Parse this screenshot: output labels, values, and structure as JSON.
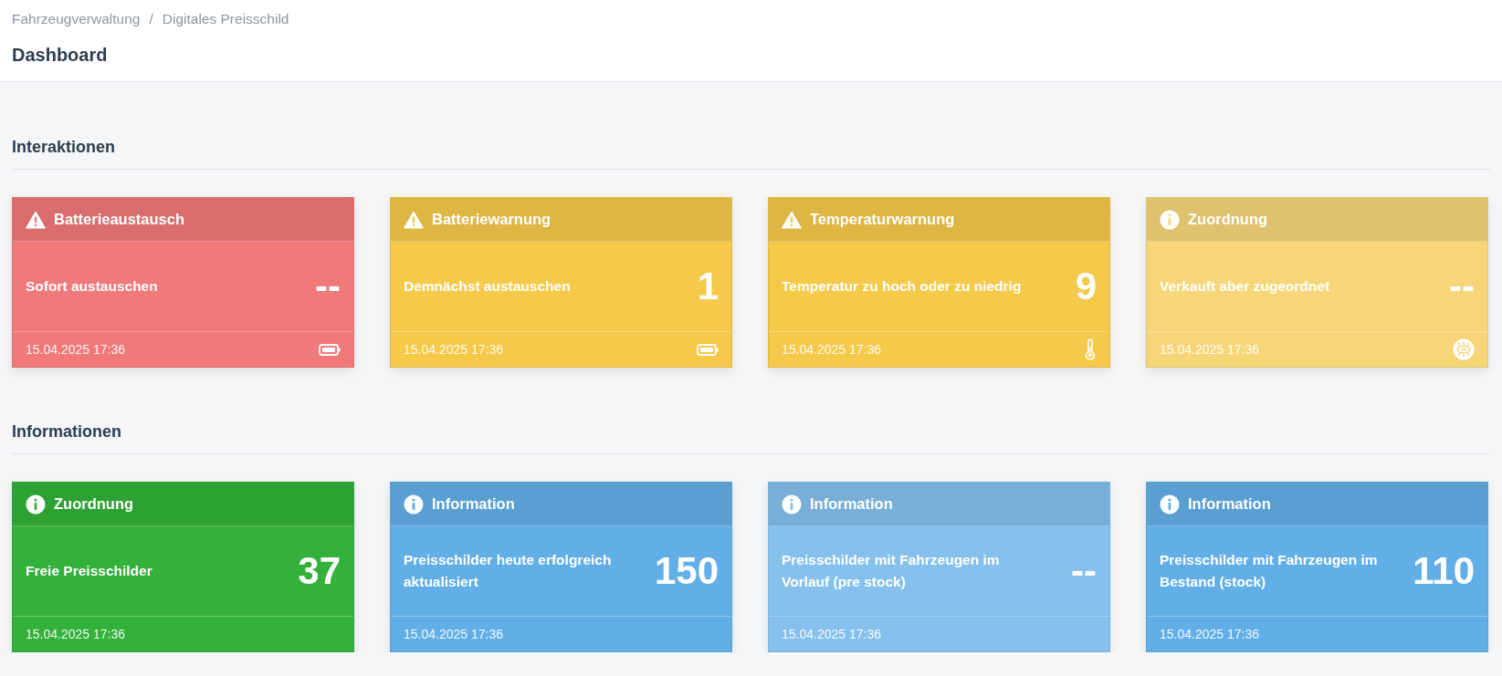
{
  "breadcrumb": [
    {
      "label": "Fahrzeugverwaltung"
    },
    {
      "separator": "/",
      "label": "Digitales Preisschild"
    }
  ],
  "page_title": "Dashboard",
  "sections": [
    {
      "title": "Interaktionen",
      "cards": [
        {
          "kind": "warning",
          "title": "Batterieaustausch",
          "label": "Sofort austauschen",
          "value": "--",
          "footer": {
            "kind": "battery",
            "timestamp": "15.04.2025 17:36"
          },
          "color": "#f07979"
        },
        {
          "kind": "warning",
          "title": "Batteriewarnung",
          "label": "Demnächst austauschen",
          "value": "1",
          "footer": {
            "kind": "battery",
            "timestamp": "15.04.2025 17:36"
          },
          "color": "#f5c94a"
        },
        {
          "kind": "warning",
          "title": "Temperaturwarnung",
          "label": "Temperatur zu hoch oder zu niedrig",
          "value": "9",
          "footer": {
            "kind": "thermometer",
            "timestamp": "15.04.2025 17:36"
          },
          "color": "#f5c94a"
        },
        {
          "kind": "info",
          "title": "Zuordnung",
          "label": "Verkauft aber zugeordnet",
          "value": "--",
          "footer": {
            "kind": "link",
            "timestamp": "15.04.2025 17:36"
          },
          "color": "#f6d678"
        }
      ]
    },
    {
      "title": "Informationen",
      "cards": [
        {
          "kind": "info",
          "title": "Zuordnung",
          "label": "Freie Preisschilder",
          "value": "37",
          "footer": {
            "kind": "plain",
            "timestamp": "15.04.2025 17:36"
          },
          "color": "#33b13a"
        },
        {
          "kind": "info",
          "title": "Information",
          "label": "Preisschilder heute erfolgreich aktualisiert",
          "value": "150",
          "footer": {
            "kind": "plain",
            "timestamp": "15.04.2025 17:36"
          },
          "color": "#62afe7"
        },
        {
          "kind": "info",
          "title": "Information",
          "label": "Preisschilder mit Fahrzeugen im Vorlauf (pre stock)",
          "value": "--",
          "footer": {
            "kind": "plain",
            "timestamp": "15.04.2025 17:36"
          },
          "color": "#86c1ed"
        },
        {
          "kind": "info",
          "title": "Information",
          "label": "Preisschilder mit Fahrzeugen im Bestand (stock)",
          "value": "110",
          "footer": {
            "kind": "plain",
            "timestamp": "15.04.2025 17:36"
          },
          "color": "#62afe7"
        }
      ]
    }
  ]
}
